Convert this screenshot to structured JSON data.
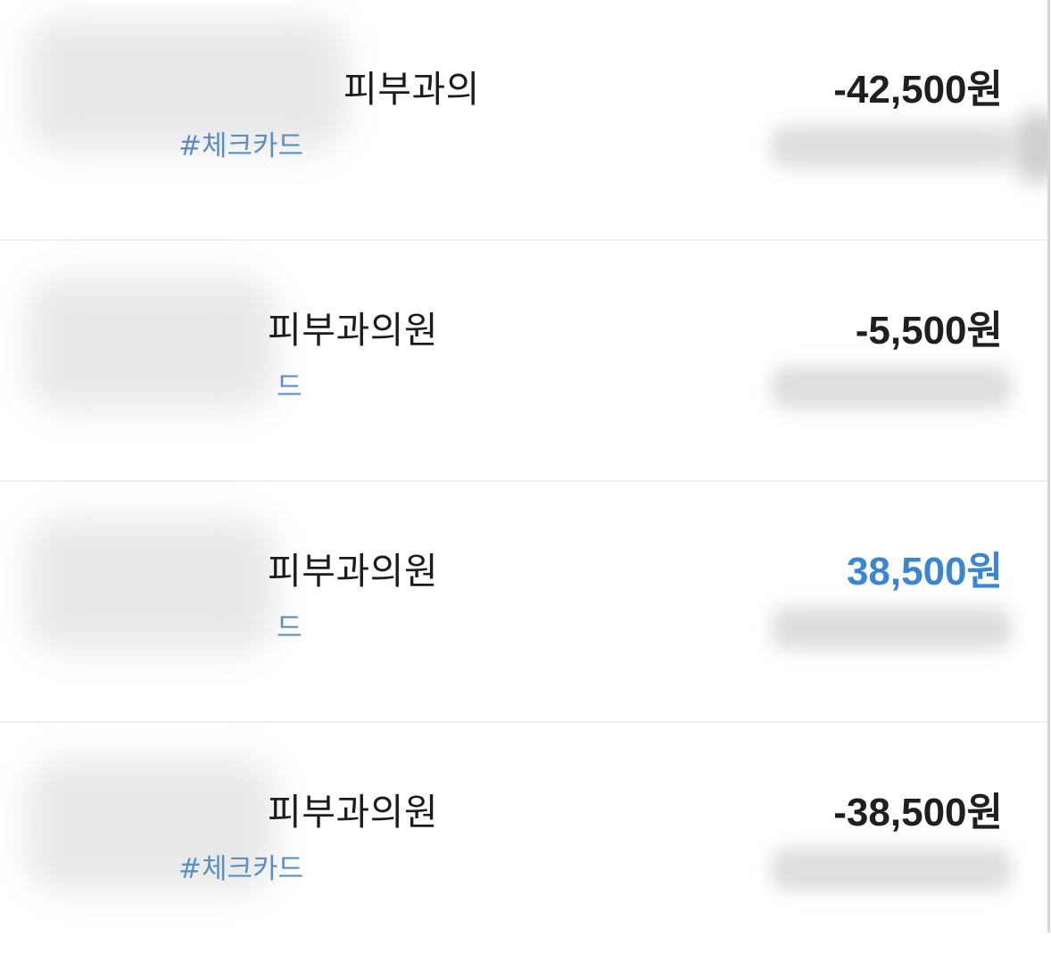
{
  "transactions": [
    {
      "merchant": "피부과의",
      "tag": "#체크카드",
      "amount": "-42,500원",
      "type": "debit"
    },
    {
      "merchant": "피부과의원",
      "tag": "드",
      "amount": "-5,500원",
      "type": "debit"
    },
    {
      "merchant": "피부과의원",
      "tag": "드",
      "amount": "38,500원",
      "type": "credit",
      "amount_color": "#3b86d1"
    },
    {
      "merchant": "피부과의원",
      "tag": "#체크카드",
      "amount": "-38,500원",
      "type": "debit"
    }
  ],
  "colors": {
    "debit_amount": "#1f1f1f",
    "credit_amount": "#3b86d1",
    "tag": "#5b8fc4",
    "divider": "#efefef"
  }
}
